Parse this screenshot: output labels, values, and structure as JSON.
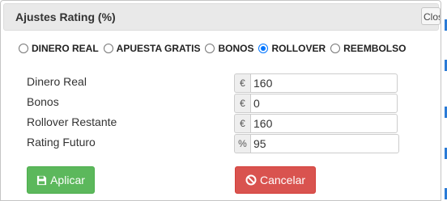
{
  "dialog": {
    "title": "Ajustes Rating (%)",
    "close_label": "Close"
  },
  "options": [
    {
      "label": "DINERO REAL",
      "checked": false
    },
    {
      "label": "APUESTA GRATIS",
      "checked": false
    },
    {
      "label": "BONOS",
      "checked": false
    },
    {
      "label": "ROLLOVER",
      "checked": true
    },
    {
      "label": "REEMBOLSO",
      "checked": false
    }
  ],
  "fields": [
    {
      "label": "Dinero Real",
      "addon": "€",
      "value": "160"
    },
    {
      "label": "Bonos",
      "addon": "€",
      "value": "0"
    },
    {
      "label": "Rollover Restante",
      "addon": "€",
      "value": "160"
    },
    {
      "label": "Rating Futuro",
      "addon": "%",
      "value": "95"
    }
  ],
  "buttons": {
    "apply_label": "Aplicar",
    "cancel_label": "Cancelar"
  },
  "colors": {
    "apply": "#5cb85c",
    "cancel": "#d9534f",
    "radio_checked": "#0075ff"
  },
  "icons": {
    "apply": "save-icon",
    "cancel": "ban-icon"
  }
}
